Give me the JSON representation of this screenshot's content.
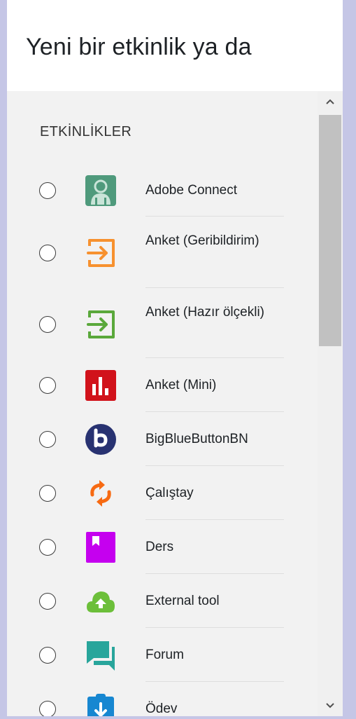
{
  "dialog": {
    "title": "Yeni bir etkinlik ya da"
  },
  "section": {
    "label": "ETKİNLİKLER"
  },
  "activities": [
    {
      "label": "Adobe Connect",
      "icon": "adobe-connect-icon",
      "color": "#4f9a7c"
    },
    {
      "label": "Anket (Geribildirim)",
      "icon": "feedback-icon",
      "color": "#f7912f"
    },
    {
      "label": "Anket (Hazır ölçekli)",
      "icon": "survey-icon",
      "color": "#5aa83b"
    },
    {
      "label": "Anket (Mini)",
      "icon": "choice-icon",
      "color": "#d1121b"
    },
    {
      "label": "BigBlueButtonBN",
      "icon": "bigbluebutton-icon",
      "color": "#283271"
    },
    {
      "label": "Çalıştay",
      "icon": "workshop-icon",
      "color": "#f76a12"
    },
    {
      "label": "Ders",
      "icon": "lesson-icon",
      "color": "#c500ef"
    },
    {
      "label": "External tool",
      "icon": "external-tool-icon",
      "color": "#6cbf3a"
    },
    {
      "label": "Forum",
      "icon": "forum-icon",
      "color": "#28a59b"
    },
    {
      "label": "Ödev",
      "icon": "assignment-icon",
      "color": "#1787d1"
    }
  ]
}
